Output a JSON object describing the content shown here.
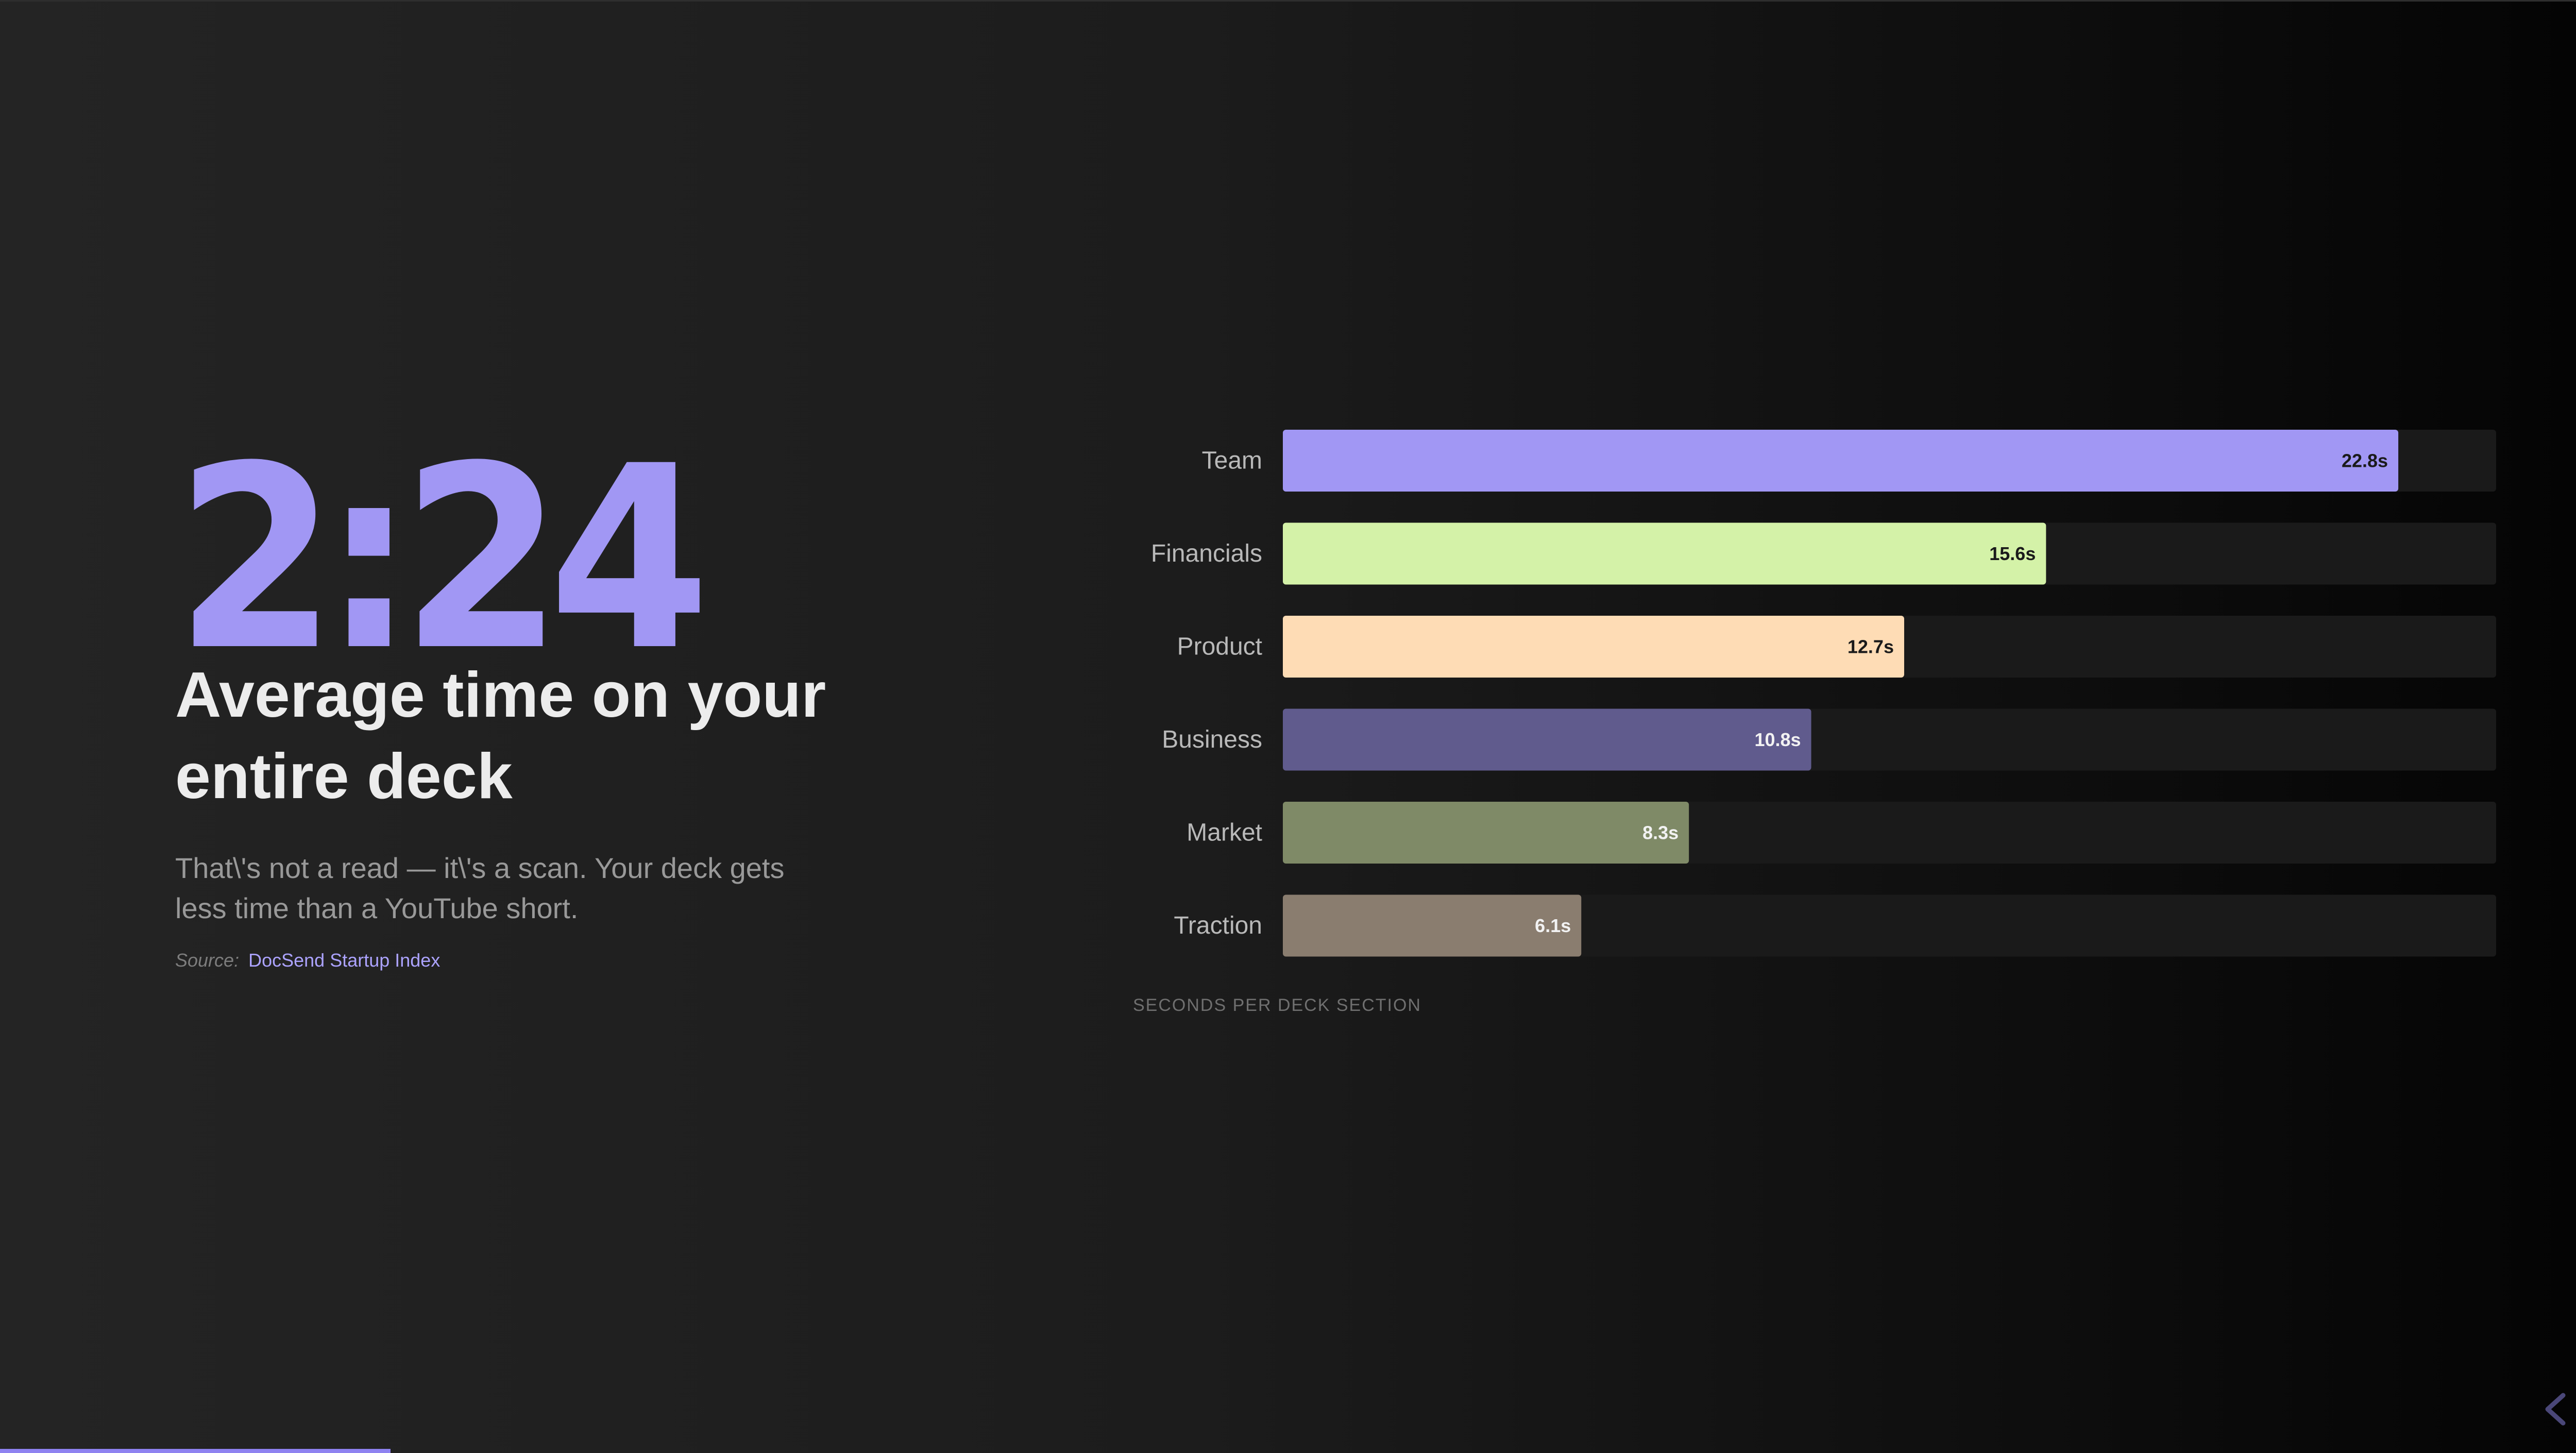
{
  "hero": {
    "stat": "2:24",
    "headline_line1": "Average time on your",
    "headline_line2": "entire deck",
    "subtext_line1": "That\\'s not a read — it\\'s a scan. Your deck gets",
    "subtext_line2": "less time than a YouTube short.",
    "source_label": "Source:",
    "source_link": "DocSend Startup Index"
  },
  "chart_data": {
    "type": "bar",
    "orientation": "horizontal",
    "categories": [
      "Team",
      "Financials",
      "Product",
      "Business",
      "Market",
      "Traction"
    ],
    "values": [
      22.8,
      15.6,
      12.7,
      10.8,
      8.3,
      6.1
    ],
    "value_labels": [
      "22.8s",
      "15.6s",
      "12.7s",
      "10.8s",
      "8.3s",
      "6.1s"
    ],
    "colors": [
      "#a197f4",
      "#d4f2a8",
      "#fedcb5",
      "#605b8d",
      "#7f8a67",
      "#8a7d6f"
    ],
    "label_colors": [
      "#1a1a1a",
      "#1a1a1a",
      "#1a1a1a",
      "#f2f2f2",
      "#f2f2f2",
      "#f2f2f2"
    ],
    "track_color": "#1a1a1a",
    "xlim": [
      0,
      24.8
    ],
    "xlabel": "SECONDS PER DECK SECTION",
    "grid": false
  },
  "nav": {
    "progress_fraction": 0.148,
    "accent": "#8e82f0"
  }
}
